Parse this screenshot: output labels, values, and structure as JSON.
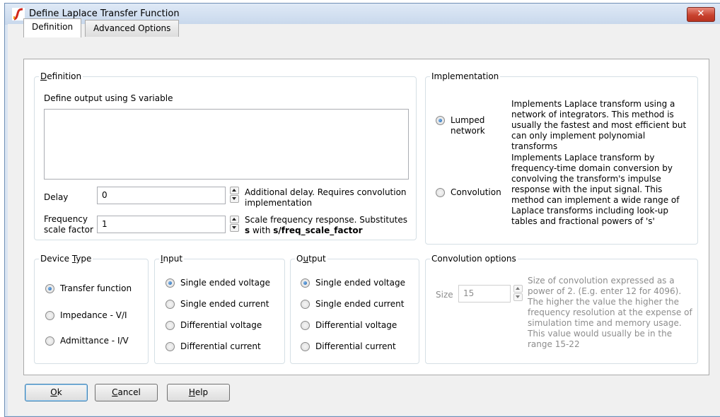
{
  "window": {
    "title": "Define Laplace Transfer Function",
    "close_glyph": "✕"
  },
  "tabs": [
    {
      "label": "Definition"
    },
    {
      "label": "Advanced Options"
    }
  ],
  "definition": {
    "group_label_rest": "efinition",
    "group_label_mnemonic": "D",
    "prompt": "Define output using S variable",
    "expression": "",
    "delay_label": "Delay",
    "delay_value": "0",
    "delay_note": "Additional delay. Requires convolution implementation",
    "freq_label_1": "Frequency",
    "freq_label_2": "scale factor",
    "freq_value": "1",
    "freq_note_1": "Scale frequency response. Substitutes",
    "freq_note_s": "s",
    "freq_note_with": " with ",
    "freq_note_sub": "s/freq_scale_factor"
  },
  "implementation": {
    "label": "Implementation",
    "lumped_label_1": "Lumped",
    "lumped_label_2": "network",
    "lumped_desc": "Implements Laplace transform using a network of integrators. This method is usually the fastest and most efficient but can only implement polynomial transforms",
    "convolution_label": "Convolution",
    "convolution_desc": "Implements Laplace transform by frequency-time domain conversion by convolving the transform's impulse response with the input signal. This method can implement a wide range of Laplace transforms including look-up tables and fractional powers of 's'"
  },
  "device_type": {
    "label_pre": "Device ",
    "label_mnemonic": "T",
    "label_post": "ype",
    "options": [
      "Transfer function",
      "Impedance - V/I",
      "Admittance - I/V"
    ]
  },
  "input": {
    "label_mnemonic": "I",
    "label_post": "nput",
    "options": [
      "Single ended voltage",
      "Single ended current",
      "Differential voltage",
      "Differential current"
    ]
  },
  "output": {
    "label_pre": "O",
    "label_mnemonic": "u",
    "label_post": "tput",
    "options": [
      "Single ended voltage",
      "Single ended current",
      "Differential voltage",
      "Differential current"
    ]
  },
  "convolution_options": {
    "label": "Convolution options",
    "size_label": "Size",
    "size_value": "15",
    "desc": "Size of convolution expressed as a power of 2. (E.g. enter 12 for 4096). The higher the value the higher the frequency resolution at the expense of simulation time and memory usage. This value would usually be in the range 15-22"
  },
  "buttons": {
    "ok_mnemonic": "O",
    "ok_rest": "k",
    "cancel_mnemonic": "C",
    "cancel_rest": "ancel",
    "help_mnemonic": "H",
    "help_rest": "elp"
  },
  "colors": {
    "title_bar": "#dae5f2",
    "close_button": "#c9432f",
    "group_border": "#d5dfe5",
    "radio_dot": "#1b5fa8"
  },
  "icons": {
    "app": "simetrix-app-icon",
    "close": "close-icon"
  }
}
